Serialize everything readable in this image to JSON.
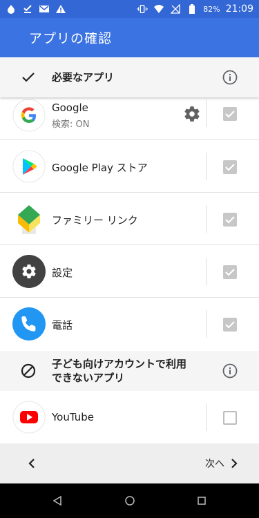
{
  "status_bar": {
    "battery": "82%",
    "time": "21:09"
  },
  "app_bar": {
    "title": "アプリの確認"
  },
  "sections": {
    "required": {
      "label": "必要なアプリ"
    },
    "unavailable": {
      "label_line1": "子ども向けアカウントで利用",
      "label_line2": "できないアプリ"
    }
  },
  "apps": [
    {
      "name": "Google",
      "subtitle": "検索: ON",
      "checked": true,
      "has_settings": true
    },
    {
      "name": "Google Play ストア",
      "checked": true
    },
    {
      "name": "ファミリー リンク",
      "checked": true
    },
    {
      "name": "設定",
      "checked": true
    },
    {
      "name": "電話",
      "checked": true
    },
    {
      "name": "YouTube",
      "checked": false
    }
  ],
  "bottom_nav": {
    "next_label": "次へ"
  },
  "colors": {
    "status_bar": "#3367d6",
    "app_bar": "#3b73e2",
    "header_bg": "#f5f5f5",
    "checkbox_checked": "#c7c7c7"
  }
}
